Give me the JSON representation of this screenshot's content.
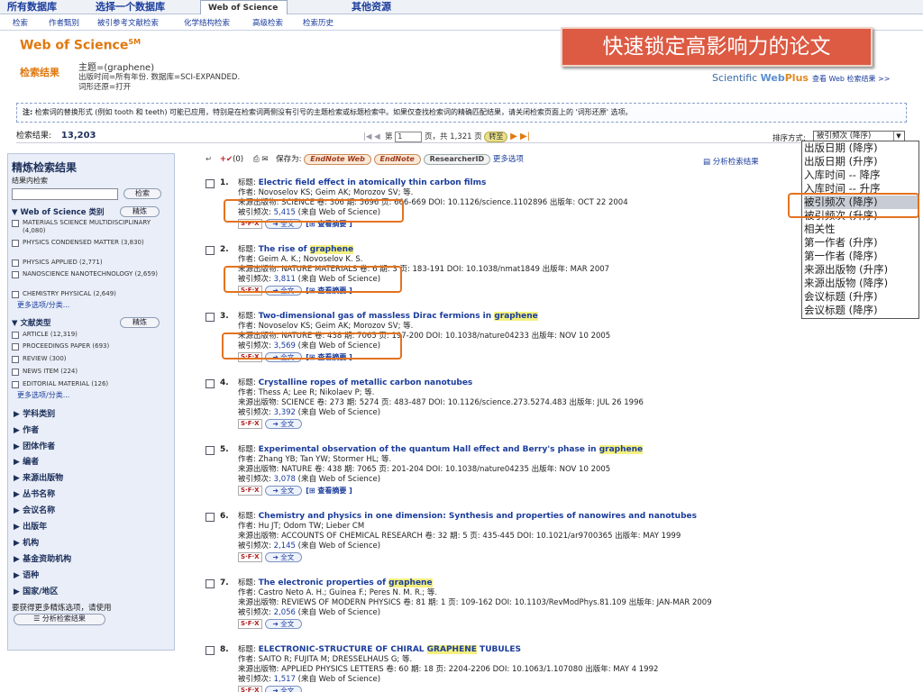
{
  "top_tabs": [
    "所有数据库",
    "选择一个数据库",
    "Web of Science",
    "其他资源"
  ],
  "sub_nav": [
    "检索",
    "作者甄别",
    "被引参考文献检索",
    "化学结构检索",
    "高级检索",
    "检索历史"
  ],
  "brand": "Web of Science",
  "brand_sup": "SM",
  "results_label": "检索结果",
  "query": {
    "line1": "主题=(graphene)",
    "line2": "出版时间=所有年份. 数据库=SCI-EXPANDED.",
    "line3": "词形还原=打开"
  },
  "webplus": {
    "scientific": "Scientific ",
    "web": "Web",
    "plus": "Plus",
    "link": "查看 Web 检索结果 >>"
  },
  "note": {
    "label": "注:",
    "text": "检索词的替换形式 (例如 tooth 和 teeth) 可能已应用，特别是在检索词两侧没有引号的主题检索或标题检索中。如果仅查找检索词的精确匹配结果，请关闭检索页面上的 '词形还原' 选项。"
  },
  "result_count_label": "检索结果:",
  "result_count": "13,203",
  "pager": {
    "page_label": "第",
    "page_value": "1",
    "total": "页，共 1,321 页",
    "go": "转至"
  },
  "sort": {
    "label": "排序方式:",
    "selected": "被引频次 (降序)",
    "options": [
      "出版日期 (降序)",
      "出版日期 (升序)",
      "入库时间 -- 降序",
      "入库时间 -- 升序",
      "被引频次 (降序)",
      "被引频次 (升序)",
      "相关性",
      "第一作者 (升序)",
      "第一作者 (降序)",
      "来源出版物 (升序)",
      "来源出版物 (降序)",
      "会议标题 (升序)",
      "会议标题 (降序)"
    ],
    "selected_index": 4
  },
  "toolbar": {
    "marked": "(0)",
    "save_to": "保存为:",
    "endnote_web": "EndNote Web",
    "endnote": "EndNote",
    "researcherid": "ResearcherID",
    "more": "更多选项",
    "analyze": "分析检索结果"
  },
  "sidebar": {
    "title": "精炼检索结果",
    "within": "结果内检索",
    "search_btn": "检索",
    "refine": "精炼",
    "wos_cat": "Web of Science 类别",
    "categories": [
      "MATERIALS SCIENCE MULTIDISCIPLINARY (4,080)",
      "PHYSICS CONDENSED MATTER (3,830)",
      "PHYSICS APPLIED (2,771)",
      "NANOSCIENCE NANOTECHNOLOGY (2,659)",
      "CHEMISTRY PHYSICAL (2,649)"
    ],
    "more": "更多选项/分类...",
    "doc_type": "文献类型",
    "doc_types": [
      "ARTICLE (12,319)",
      "PROCEEDINGS PAPER (693)",
      "REVIEW (300)",
      "NEWS ITEM (224)",
      "EDITORIAL MATERIAL (126)"
    ],
    "facets": [
      "学科类别",
      "作者",
      "团体作者",
      "编者",
      "来源出版物",
      "丛书名称",
      "会议名称",
      "出版年",
      "机构",
      "基金资助机构",
      "语种",
      "国家/地区"
    ],
    "foot": "要获得更多精炼选项，请使用",
    "analyze_btn": "分析检索结果"
  },
  "labels": {
    "title": "标题:",
    "author": "作者:",
    "source": "来源出版物:",
    "cited": "被引频次:",
    "from_wos": "(来自 Web of Science)",
    "sfx": "S·F·X",
    "full": "全文",
    "abstract": "[⊞ 查看摘要 ]"
  },
  "records": [
    {
      "num": "1.",
      "pre": "Electric field effect in atomically thin carbon films",
      "hl": "",
      "post": "",
      "authors": "Novoselov KS; Geim AK; Morozov SV; 等.",
      "source": "SCIENCE  卷: 306  期: 5696  页: 666-669  DOI: 10.1126/science.1102896  出版年: OCT 22 2004",
      "cited": "5,415"
    },
    {
      "num": "2.",
      "pre": "The rise of ",
      "hl": "graphene",
      "post": "",
      "authors": "Geim A. K.; Novoselov K. S.",
      "source": "NATURE MATERIALS  卷: 6  期: 3  页: 183-191  DOI: 10.1038/nmat1849  出版年: MAR 2007",
      "cited": "3,811"
    },
    {
      "num": "3.",
      "pre": "Two-dimensional gas of massless Dirac fermions in ",
      "hl": "graphene",
      "post": "",
      "authors": "Novoselov KS; Geim AK; Morozov SV; 等.",
      "source": "NATURE  卷: 438  期: 7065  页: 197-200  DOI: 10.1038/nature04233  出版年: NOV 10 2005",
      "cited": "3,569"
    },
    {
      "num": "4.",
      "pre": "Crystalline ropes of metallic carbon nanotubes",
      "hl": "",
      "post": "",
      "authors": "Thess A; Lee R; Nikolaev P; 等.",
      "source": "SCIENCE  卷: 273  期: 5274  页: 483-487  DOI: 10.1126/science.273.5274.483  出版年: JUL 26 1996",
      "cited": "3,392"
    },
    {
      "num": "5.",
      "pre": "Experimental observation of the quantum Hall effect and Berry's phase in ",
      "hl": "graphene",
      "post": "",
      "authors": "Zhang YB; Tan YW; Stormer HL; 等.",
      "source": "NATURE  卷: 438  期: 7065  页: 201-204  DOI: 10.1038/nature04235  出版年: NOV 10 2005",
      "cited": "3,078"
    },
    {
      "num": "6.",
      "pre": "Chemistry and physics in one dimension: Synthesis and properties of nanowires and nanotubes",
      "hl": "",
      "post": "",
      "authors": "Hu JT; Odom TW; Lieber CM",
      "source": "ACCOUNTS OF CHEMICAL RESEARCH  卷: 32  期: 5  页: 435-445  DOI: 10.1021/ar9700365  出版年: MAY 1999",
      "cited": "2,145"
    },
    {
      "num": "7.",
      "pre": "The electronic properties of ",
      "hl": "graphene",
      "post": "",
      "authors": "Castro Neto A. H.; Guinea F.; Peres N. M. R.; 等.",
      "source": "REVIEWS OF MODERN PHYSICS  卷: 81  期: 1  页: 109-162  DOI: 10.1103/RevModPhys.81.109  出版年: JAN-MAR 2009",
      "cited": "2,056"
    },
    {
      "num": "8.",
      "pre": "ELECTRONIC-STRUCTURE OF CHIRAL ",
      "hl": "GRAPHENE",
      "post": " TUBULES",
      "authors": "SAITO R; FUJITA M; DRESSELHAUS G; 等.",
      "source": "APPLIED PHYSICS LETTERS  卷: 60  期: 18  页: 2204-2206  DOI: 10.1063/1.107080  出版年: MAY 4 1992",
      "cited": "1,517"
    }
  ],
  "banner": "快速锁定高影响力的论文",
  "colors": {
    "accent_orange": "#e4731f",
    "banner_red": "#dd5a43",
    "link_blue": "#1a3c9c",
    "highlight": "#f4f080"
  }
}
